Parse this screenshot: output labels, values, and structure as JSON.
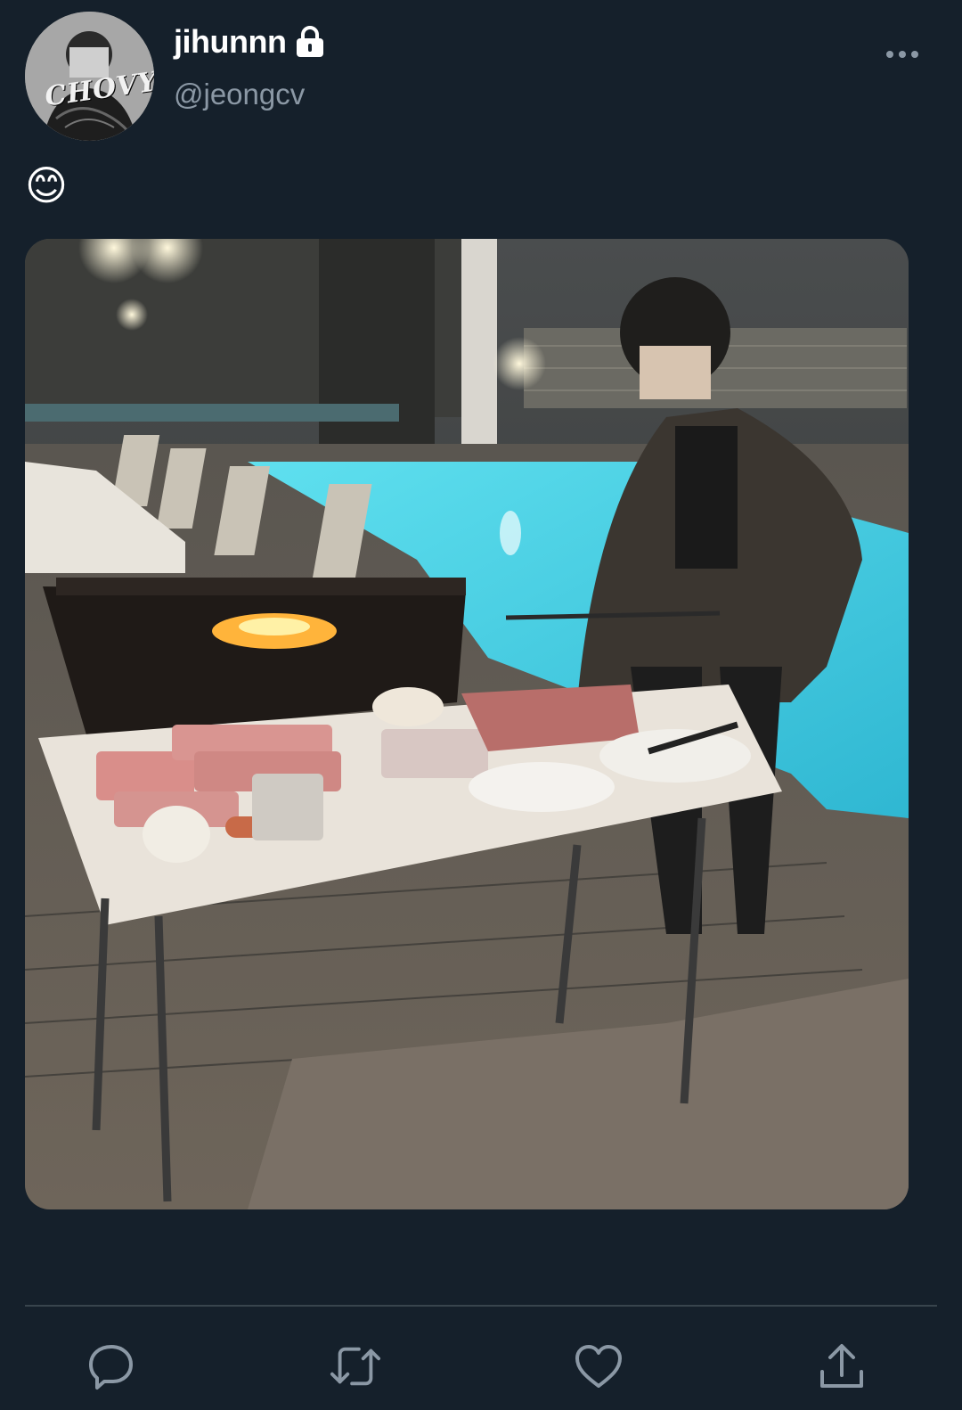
{
  "tweet": {
    "display_name": "jihunnn",
    "username": "@jeongcv",
    "text": "😊",
    "avatar_text": "CHOVY",
    "protected_icon": "lock-icon",
    "more_icon": "more-horizontal-icon"
  },
  "actions": [
    {
      "name": "reply",
      "icon": "reply-icon"
    },
    {
      "name": "retweet",
      "icon": "retweet-icon"
    },
    {
      "name": "like",
      "icon": "heart-icon"
    },
    {
      "name": "share",
      "icon": "share-icon"
    }
  ],
  "colors": {
    "background": "#15202b",
    "secondary_text": "#8b98a5",
    "divider": "#38444d",
    "pool": "#4fd3e6"
  }
}
